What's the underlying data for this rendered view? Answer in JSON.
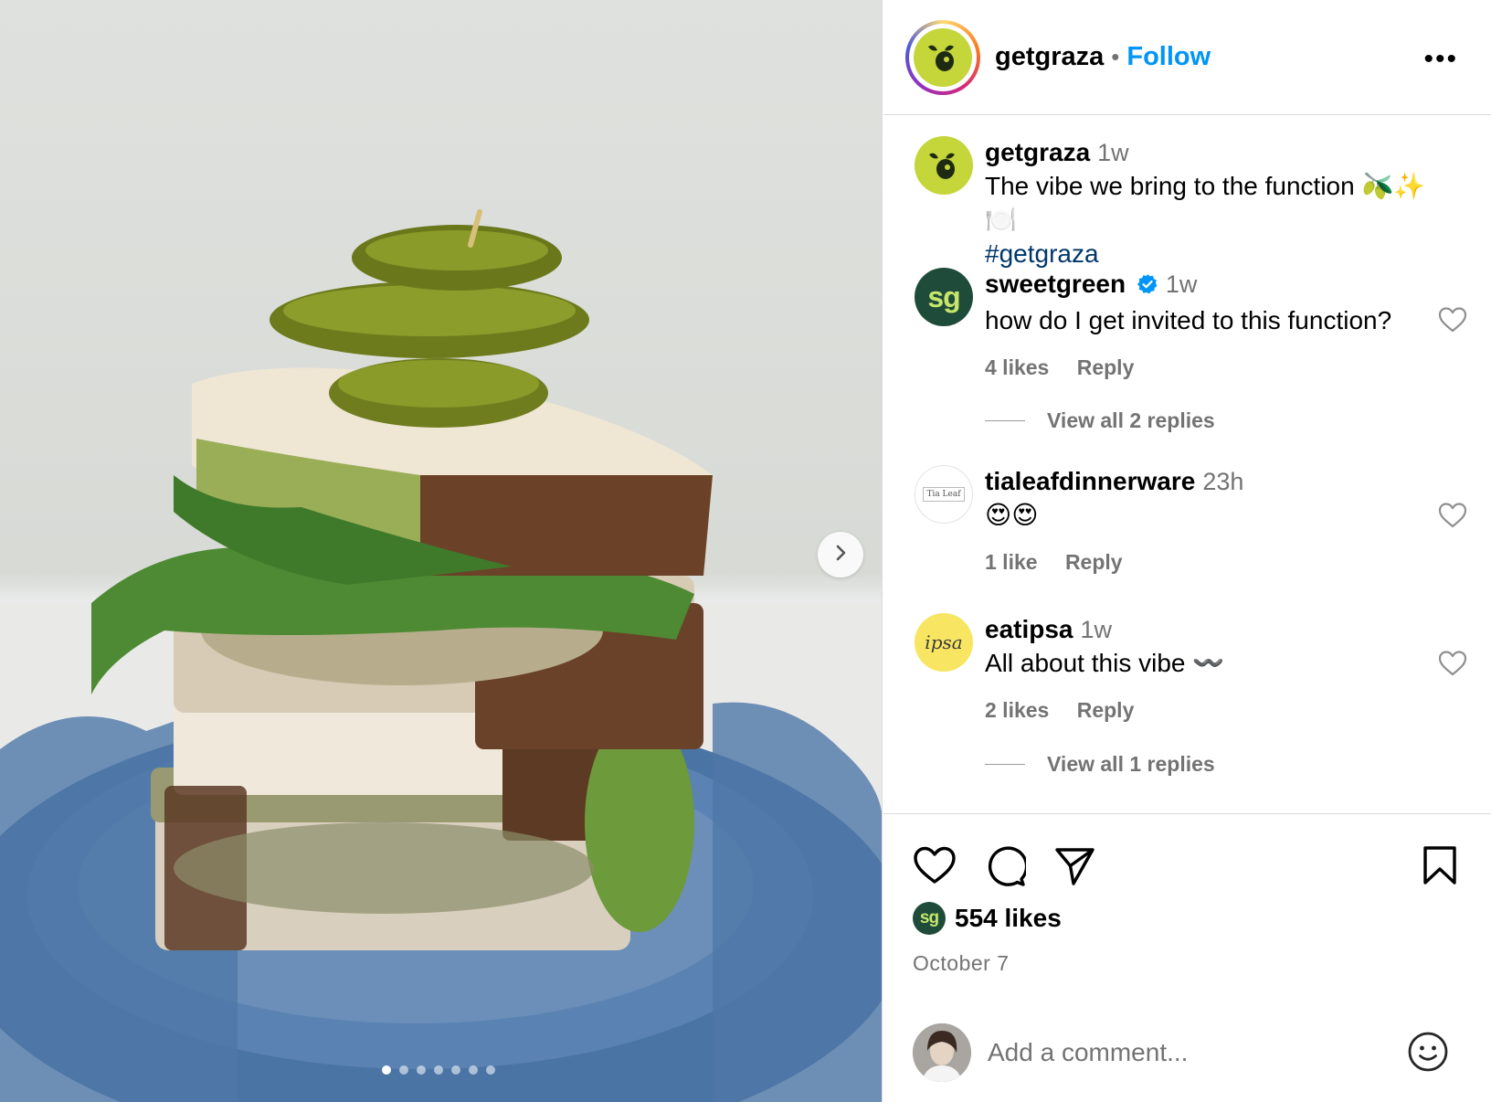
{
  "post": {
    "slide_count": 7,
    "active_slide": 1
  },
  "header": {
    "username": "getgraza",
    "separator": "•",
    "follow_label": "Follow",
    "more_label": "•••"
  },
  "caption": {
    "username": "getgraza",
    "time": "1w",
    "text": "The vibe we bring to the function 🫒✨🍽️",
    "hashtag": "#getgraza"
  },
  "comments": [
    {
      "username": "sweetgreen",
      "verified": true,
      "avatar_text": "sg",
      "time": "1w",
      "text": "how do I get invited to this function?",
      "likes": "4 likes",
      "reply_label": "Reply",
      "view_replies": "View all 2 replies"
    },
    {
      "username": "tialeafdinnerware",
      "avatar_text": "Tia Leaf",
      "time": "23h",
      "text": "😍😍",
      "likes": "1 like",
      "reply_label": "Reply"
    },
    {
      "username": "eatipsa",
      "avatar_text": "ipsa",
      "time": "1w",
      "text": "All about this vibe 〰️",
      "likes": "2 likes",
      "reply_label": "Reply",
      "view_replies": "View all 1 replies"
    }
  ],
  "footer": {
    "likes_avatar_text": "sg",
    "likes": "554 likes",
    "date": "October 7",
    "comment_placeholder": "Add a comment..."
  },
  "colors": {
    "follow_blue": "#0095f6",
    "graza_green": "#c4d63a",
    "sweetgreen_dark": "#1f4b3a",
    "ipsa_yellow": "#f8e561",
    "hashtag_navy": "#00376b"
  }
}
